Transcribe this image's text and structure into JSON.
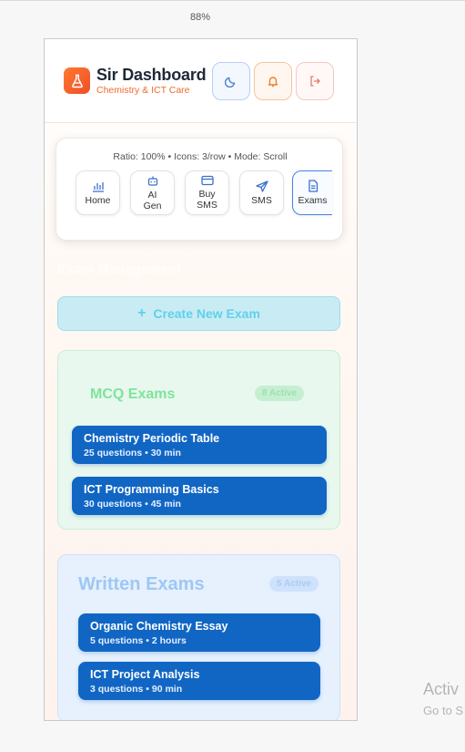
{
  "zoom": "88%",
  "header": {
    "title": "Sir Dashboard",
    "subtitle": "Chemistry & ICT Care"
  },
  "nav": {
    "info": "Ratio: 100% • Icons: 3/row • Mode: Scroll",
    "items": [
      {
        "label": "Home",
        "icon": "chart-icon"
      },
      {
        "label": "AI\nGen",
        "icon": "robot-icon"
      },
      {
        "label": "Buy\nSMS",
        "icon": "card-icon"
      },
      {
        "label": "SMS",
        "icon": "send-icon"
      },
      {
        "label": "Exams",
        "icon": "document-icon"
      }
    ]
  },
  "page_title": "Exam Management",
  "create_button": "Create New Exam",
  "mcq": {
    "title": "MCQ Exams",
    "badge": "8 Active",
    "exams": [
      {
        "title": "Chemistry Periodic Table",
        "meta": "25 questions • 30 min"
      },
      {
        "title": "ICT Programming Basics",
        "meta": "30 questions • 45 min"
      }
    ]
  },
  "written": {
    "title": "Written Exams",
    "badge": "5 Active",
    "exams": [
      {
        "title": "Organic Chemistry Essay",
        "meta": "5 questions • 2 hours"
      },
      {
        "title": "ICT Project Analysis",
        "meta": "3 questions • 90 min"
      }
    ]
  },
  "watermark": {
    "line1": "Activ",
    "line2": "Go to S"
  },
  "colors": {
    "accent_orange": "#f26a2b",
    "exam_card": "#1166c4",
    "active_tab": "#4a82dd"
  }
}
